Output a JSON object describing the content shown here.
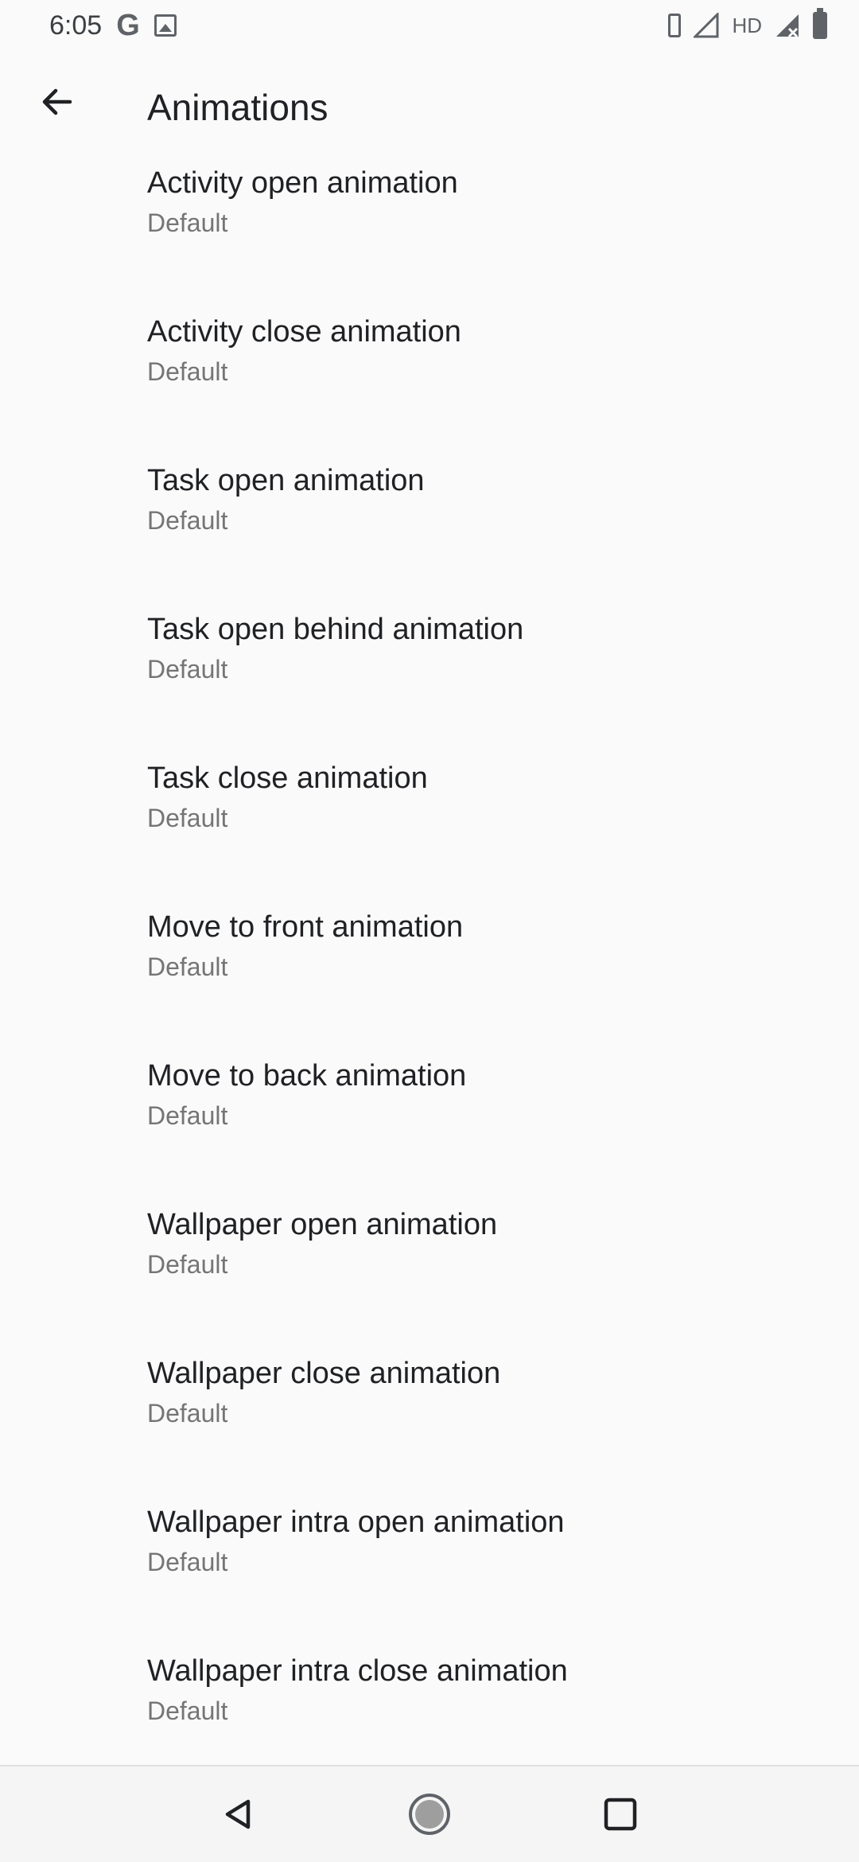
{
  "status_bar": {
    "time": "6:05",
    "g_label": "G",
    "hd_label": "HD"
  },
  "app_bar": {
    "title": "Animations"
  },
  "settings": {
    "items": [
      {
        "title": "Activity open animation",
        "summary": "Default"
      },
      {
        "title": "Activity close animation",
        "summary": "Default"
      },
      {
        "title": "Task open animation",
        "summary": "Default"
      },
      {
        "title": "Task open behind animation",
        "summary": "Default"
      },
      {
        "title": "Task close animation",
        "summary": "Default"
      },
      {
        "title": "Move to front animation",
        "summary": "Default"
      },
      {
        "title": "Move to back animation",
        "summary": "Default"
      },
      {
        "title": "Wallpaper open animation",
        "summary": "Default"
      },
      {
        "title": "Wallpaper close animation",
        "summary": "Default"
      },
      {
        "title": "Wallpaper intra open animation",
        "summary": "Default"
      },
      {
        "title": "Wallpaper intra close animation",
        "summary": "Default"
      }
    ]
  },
  "icons": {
    "back": "arrow-back-icon",
    "nav_back": "triangle-back-icon",
    "nav_home": "circle-home-icon",
    "nav_recents": "square-recents-icon"
  },
  "colors": {
    "background": "#fafafa",
    "title_text": "#202124",
    "summary_text": "#757575",
    "icon": "#5f6368"
  }
}
